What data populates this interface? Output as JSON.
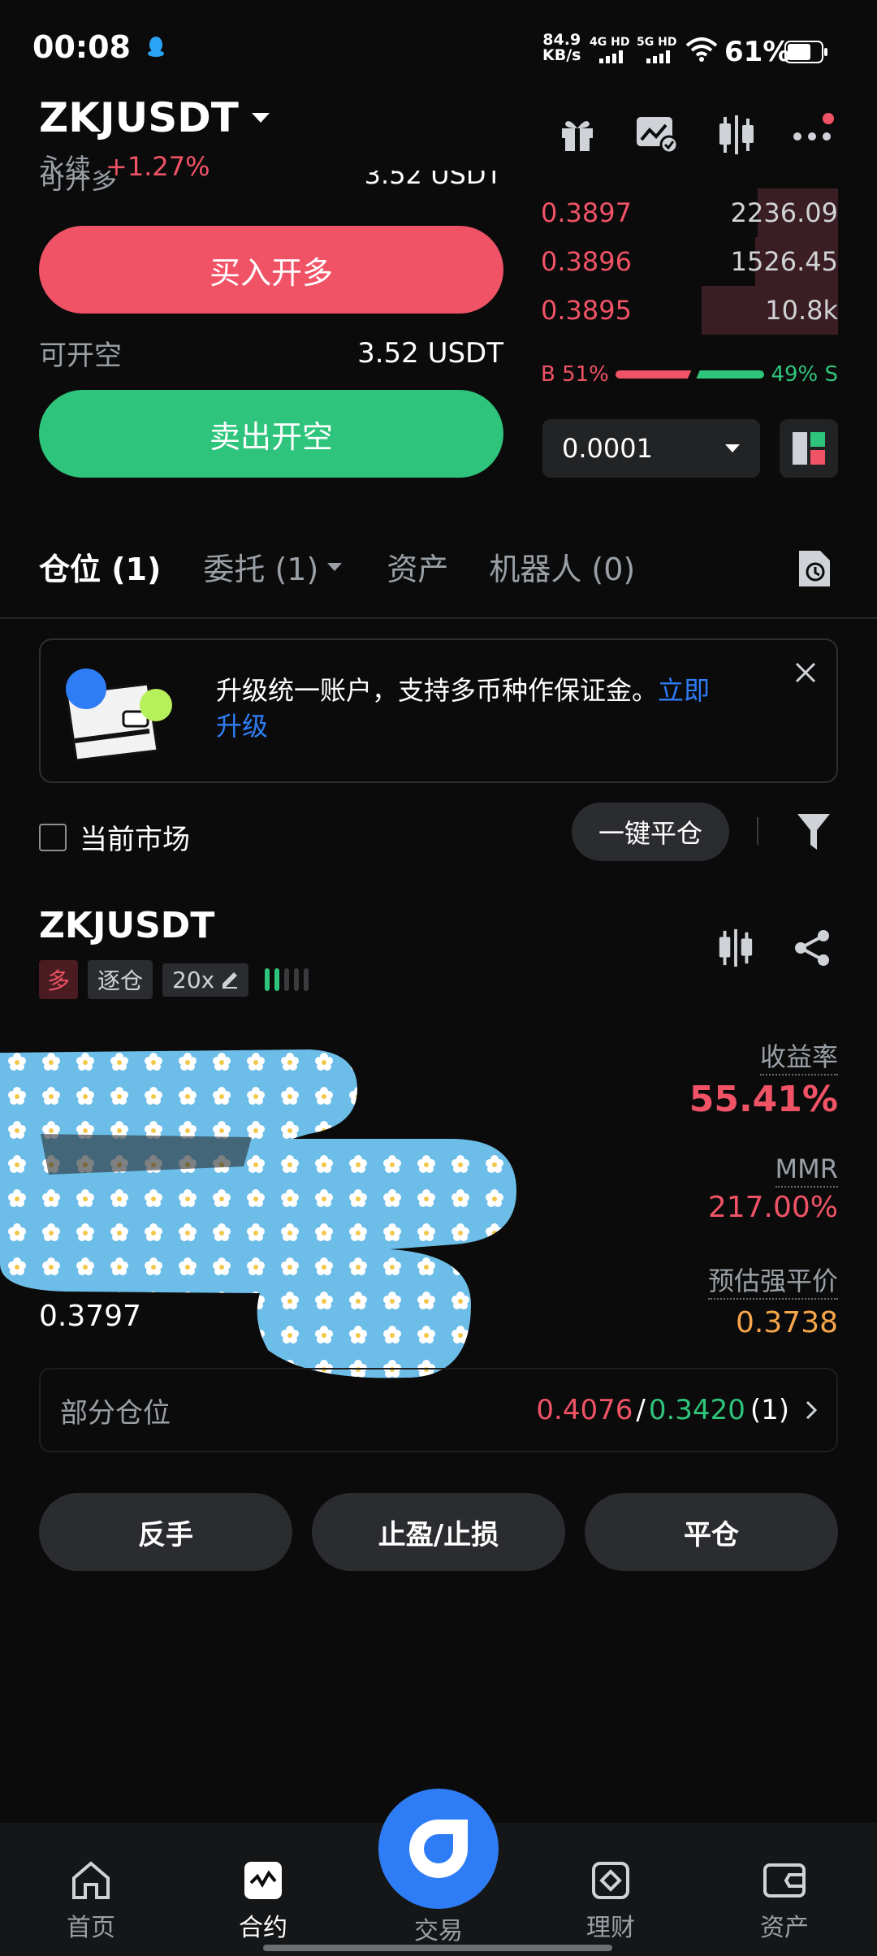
{
  "status": {
    "time": "00:08",
    "net_speed_top": "84.9",
    "net_speed_bottom": "KB/s",
    "network1": "4G HD",
    "network2": "5G HD",
    "battery": "61%"
  },
  "header": {
    "pair": "ZKJUSDT",
    "type": "永续",
    "change": "+1.27%"
  },
  "trade": {
    "avail_long_label": "可开多",
    "avail_long_value": "3.52 USDT",
    "buy_button": "买入开多",
    "avail_short_label": "可开空",
    "avail_short_value": "3.52 USDT",
    "sell_button": "卖出开空"
  },
  "orderbook": {
    "asks": [
      {
        "price": "0.3897",
        "qty": "2236.09",
        "depth": 0.27
      },
      {
        "price": "0.3896",
        "qty": "1526.45",
        "depth": 0.28
      },
      {
        "price": "0.3895",
        "qty": "10.8k",
        "depth": 0.46
      }
    ],
    "b_label": "B 51%",
    "s_label": "49% S",
    "b_ratio": 0.51,
    "precision": "0.0001"
  },
  "tabs": [
    {
      "label": "仓位 (1)"
    },
    {
      "label": "委托 (1)"
    },
    {
      "label": "资产"
    },
    {
      "label": "机器人 (0)"
    }
  ],
  "banner": {
    "text": "升级统一账户，支持多币种作保证金。",
    "link_a": "立即",
    "link_b": "升级"
  },
  "filter": {
    "current_market": "当前市场",
    "close_all": "一键平仓"
  },
  "position": {
    "symbol": "ZKJUSDT",
    "side": "多",
    "margin_mode": "逐仓",
    "leverage": "20x",
    "roe_label": "收益率",
    "roe_value": "55.41%",
    "mmr_label": "MMR",
    "mmr_value": "217.00%",
    "liq_label": "预估强平价",
    "liq_value": "0.3738",
    "entry_value": "0.3797",
    "partial_label": "部分仓位",
    "tp": "0.4076",
    "sl": "0.3420",
    "count": "(1)",
    "action_reverse": "反手",
    "action_tpsl": "止盈/止损",
    "action_close": "平仓"
  },
  "nav": [
    {
      "label": "首页"
    },
    {
      "label": "合约"
    },
    {
      "label": "交易"
    },
    {
      "label": "理财"
    },
    {
      "label": "资产"
    }
  ],
  "colors": {
    "buy": "#f05366",
    "sell": "#2fc47b",
    "link": "#2f7df6"
  }
}
